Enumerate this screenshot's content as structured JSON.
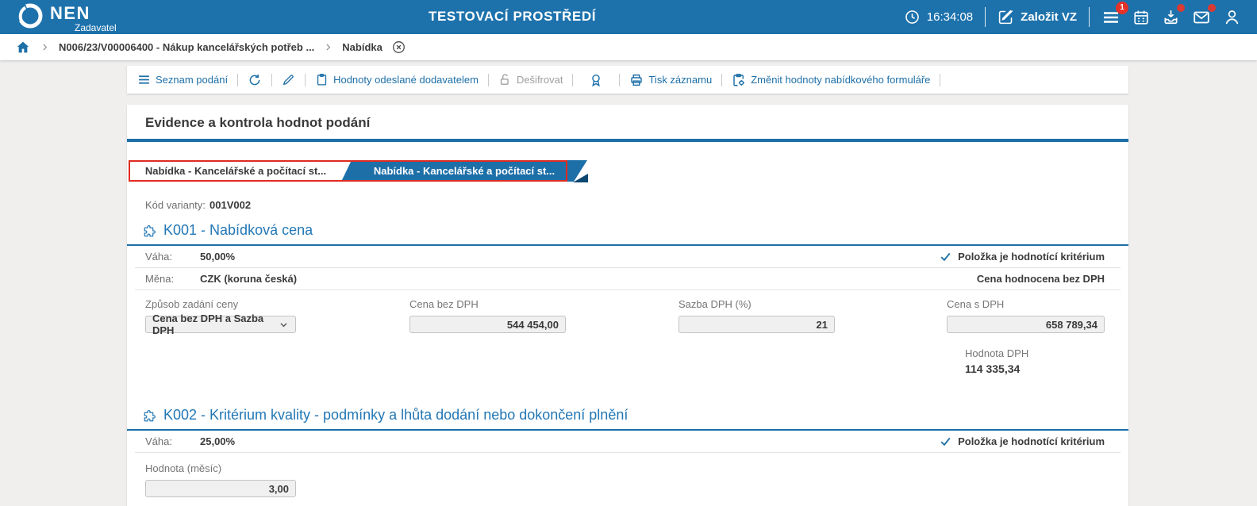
{
  "colors": {
    "header_blue": "#1d72ac",
    "link_blue": "#1d6fa8",
    "section_blue": "#2277b5",
    "tab_active_blue": "#1d6fa8",
    "highlight_red": "#e02b20",
    "badge_red": "#e53228",
    "text_dark": "#3a3a3a",
    "label_gray": "#757575"
  },
  "header": {
    "brand": "NEN",
    "brand_subtitle": "Zadavatel",
    "environment": "TESTOVACÍ PROSTŘEDÍ",
    "time": "16:34:08",
    "create_button": "Založit VZ",
    "menu_badge": "1",
    "icons": [
      "clock-icon",
      "edit-icon",
      "menu-icon",
      "calendar-icon",
      "download-icon",
      "mail-icon",
      "user-icon"
    ]
  },
  "breadcrumb": {
    "contract": "N006/23/V00006400 - Nákup kancelářských potřeb ...",
    "current": "Nabídka"
  },
  "toolbar": {
    "list": "Seznam podání",
    "values_sent": "Hodnoty odeslané dodavatelem",
    "decrypt": "Dešifrovat",
    "print": "Tisk záznamu",
    "change_values": "Změnit hodnoty nabídkového formuláře"
  },
  "page": {
    "title": "Evidence a kontrola hodnot podání",
    "tabs": [
      {
        "label": "Nabídka - Kancelářské a počítací st..."
      },
      {
        "label": "Nabídka - Kancelářské a počítací st..."
      }
    ],
    "variant_label": "Kód varianty:",
    "variant_value": "001V002"
  },
  "k001": {
    "title": "K001 - Nabídková cena",
    "weight_label": "Váha:",
    "weight_value": "50,00%",
    "currency_label": "Měna:",
    "currency_value": "CZK (koruna česká)",
    "criterion_note": "Položka je hodnotící kritérium",
    "vat_note": "Cena hodnocena bez DPH",
    "price_mode_label": "Způsob zadání ceny",
    "price_mode_value": "Cena bez DPH a Sazba DPH",
    "price_excl_label": "Cena bez DPH",
    "price_excl_value": "544 454,00",
    "vat_rate_label": "Sazba DPH (%)",
    "vat_rate_value": "21",
    "price_incl_label": "Cena s DPH",
    "price_incl_value": "658 789,34",
    "vat_amount_label": "Hodnota DPH",
    "vat_amount_value": "114 335,34"
  },
  "k002": {
    "title": "K002 - Kritérium kvality - podmínky a lhůta dodání nebo dokončení plnění",
    "weight_label": "Váha:",
    "weight_value": "25,00%",
    "criterion_note": "Položka je hodnotící kritérium",
    "value_label": "Hodnota (měsíc)",
    "value_value": "3,00"
  }
}
